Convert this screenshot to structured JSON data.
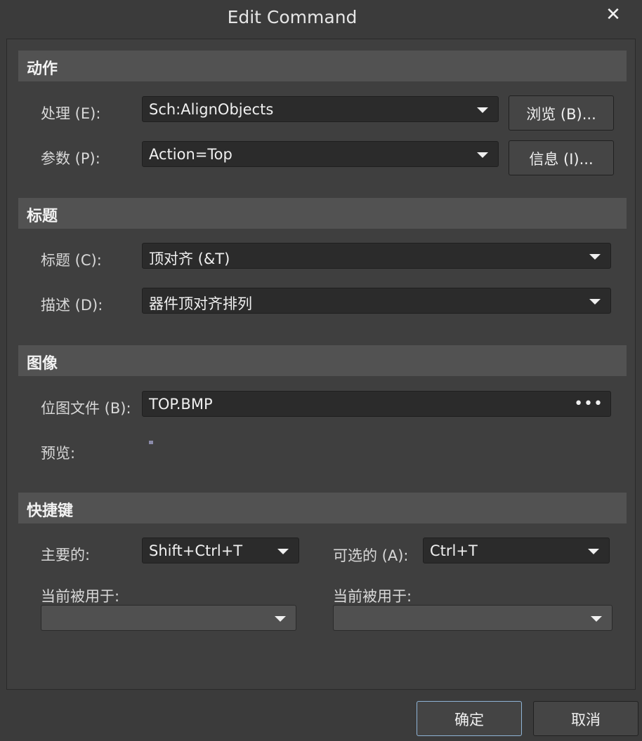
{
  "dialog": {
    "title": "Edit Command",
    "close_glyph": "✕"
  },
  "sections": {
    "action": "动作",
    "caption": "标题",
    "image": "图像",
    "shortcut": "快捷键"
  },
  "action": {
    "process_label": "处理 (E):",
    "process_value": "Sch:AlignObjects",
    "browse_button": "浏览 (B)...",
    "params_label": "参数 (P):",
    "params_value": "Action=Top",
    "info_button": "信息 (I)..."
  },
  "caption": {
    "caption_label": "标题 (C):",
    "caption_value": "顶对齐 (&T)",
    "desc_label": "描述 (D):",
    "desc_value": "器件顶对齐排列"
  },
  "image": {
    "bitmap_label": "位图文件 (B):",
    "bitmap_value": "TOP.BMP",
    "browse_glyph": "•••",
    "preview_label": "预览:"
  },
  "shortcut": {
    "primary_label": "主要的:",
    "primary_value": "Shift+Ctrl+T",
    "alternate_label": "可选的 (A):",
    "alternate_value": "Ctrl+T",
    "used_by_label_left": "当前被用于:",
    "used_by_label_right": "当前被用于:"
  },
  "footer": {
    "ok": "确定",
    "cancel": "取消"
  }
}
